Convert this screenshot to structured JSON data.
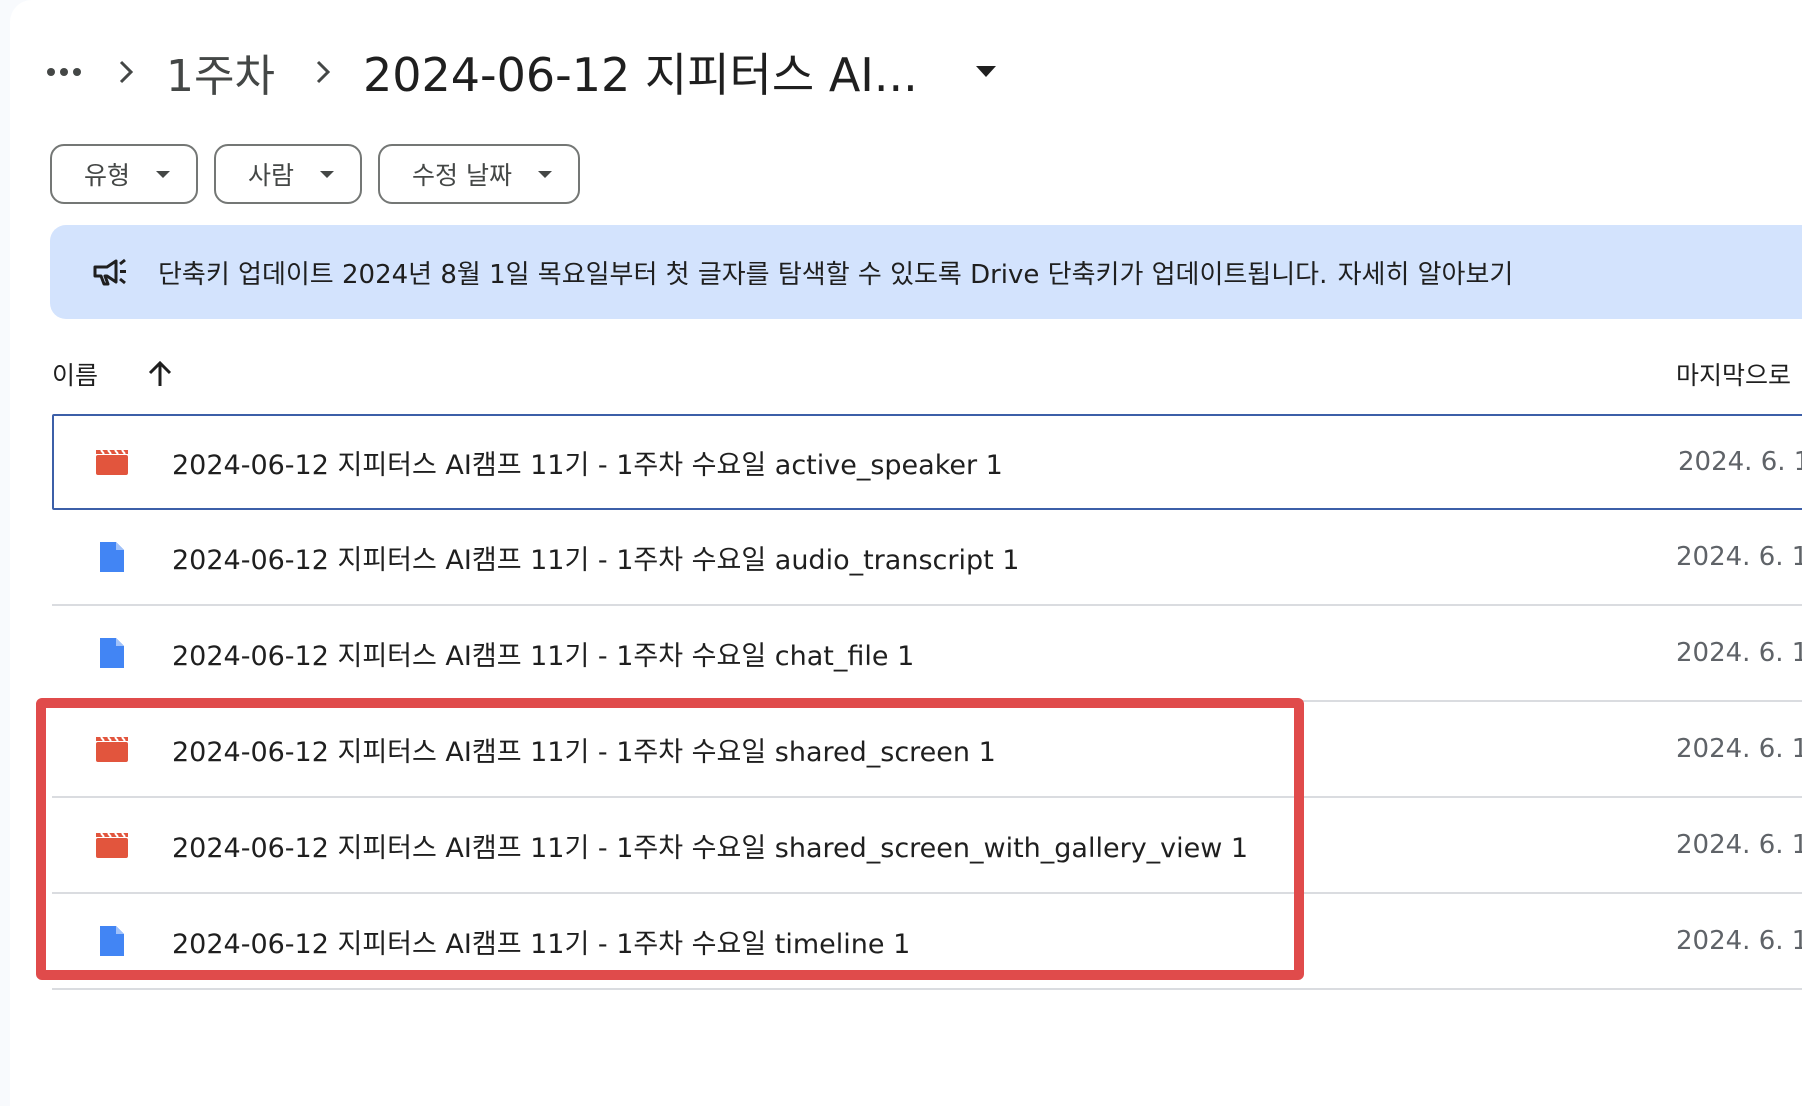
{
  "breadcrumb": {
    "more_label": "…",
    "parent": "1주차",
    "current": "2024-06-12 지피터스 AI..."
  },
  "filters": [
    {
      "label": "유형"
    },
    {
      "label": "사람"
    },
    {
      "label": "수정 날짜"
    }
  ],
  "banner": {
    "icon": "megaphone-icon",
    "title": "단축키 업데이트",
    "message": "2024년 8월 1일 목요일부터 첫 글자를 탐색할 수 있도록 Drive 단축키가 업데이트됩니다.",
    "link": "자세히 알아보기"
  },
  "table": {
    "name_header": "이름",
    "sort_icon": "arrow-up-icon",
    "modified_header": "마지막으로"
  },
  "files": [
    {
      "name": "2024-06-12 지피터스 AI캠프 11기 - 1주차 수요일 active_speaker 1",
      "type": "video",
      "date": "2024. 6. 1"
    },
    {
      "name": "2024-06-12 지피터스 AI캠프 11기 - 1주차 수요일 audio_transcript 1",
      "type": "doc",
      "date": "2024. 6. 1"
    },
    {
      "name": "2024-06-12 지피터스 AI캠프 11기 - 1주차 수요일 chat_file 1",
      "type": "doc",
      "date": "2024. 6. 1"
    },
    {
      "name": "2024-06-12 지피터스 AI캠프 11기 - 1주차 수요일 shared_screen 1",
      "type": "video",
      "date": "2024. 6. 1"
    },
    {
      "name": "2024-06-12 지피터스 AI캠프 11기 - 1주차 수요일 shared_screen_with_gallery_view 1",
      "type": "video",
      "date": "2024. 6. 1"
    },
    {
      "name": "2024-06-12 지피터스 AI캠프 11기 - 1주차 수요일 timeline 1",
      "type": "doc",
      "date": "2024. 6. 1"
    }
  ],
  "colors": {
    "video_icon": "#e2553d",
    "doc_icon": "#4285f4",
    "banner_bg": "#d3e3fd",
    "selection_border": "#3c5fa8",
    "highlight": "#e04b4b"
  }
}
